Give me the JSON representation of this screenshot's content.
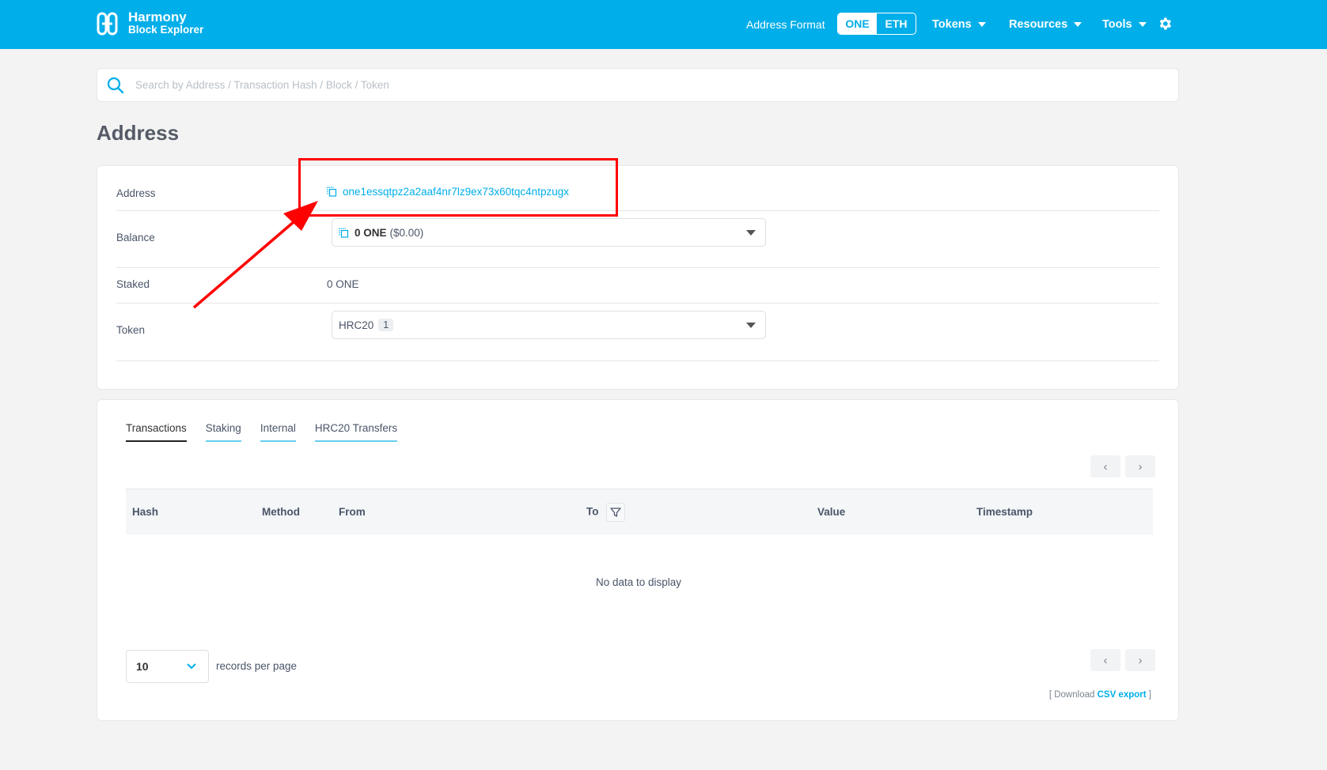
{
  "header": {
    "brand_line1": "Harmony",
    "brand_line2": "Block Explorer",
    "address_format_label": "Address Format",
    "format_options": [
      "ONE",
      "ETH"
    ],
    "menus": [
      "Tokens",
      "Resources",
      "Tools"
    ]
  },
  "search": {
    "placeholder": "Search by Address / Transaction Hash / Block / Token"
  },
  "page_title": "Address",
  "address_card": {
    "address_label": "Address",
    "address_value": "one1essqtpz2a2aaf4nr7lz9ex73x60tqc4ntpzugx",
    "balance_label": "Balance",
    "balance_amount": "0 ONE",
    "balance_usd": "($0.00)",
    "staked_label": "Staked",
    "staked_value": "0 ONE",
    "token_label": "Token",
    "token_value": "HRC20",
    "token_count": "1"
  },
  "tabs": [
    "Transactions",
    "Staking",
    "Internal",
    "HRC20 Transfers"
  ],
  "table": {
    "columns": [
      "Hash",
      "Method",
      "From",
      "To",
      "Value",
      "Timestamp"
    ],
    "empty_text": "No data to display"
  },
  "pagination": {
    "prev": "‹",
    "next": "›",
    "records_per_page_value": "10",
    "records_per_page_label": "records per page"
  },
  "export": {
    "prefix": "[ Download",
    "link": "CSV export",
    "suffix": "]"
  },
  "colors": {
    "brand": "#00aee9",
    "annotation": "#ff0000"
  }
}
